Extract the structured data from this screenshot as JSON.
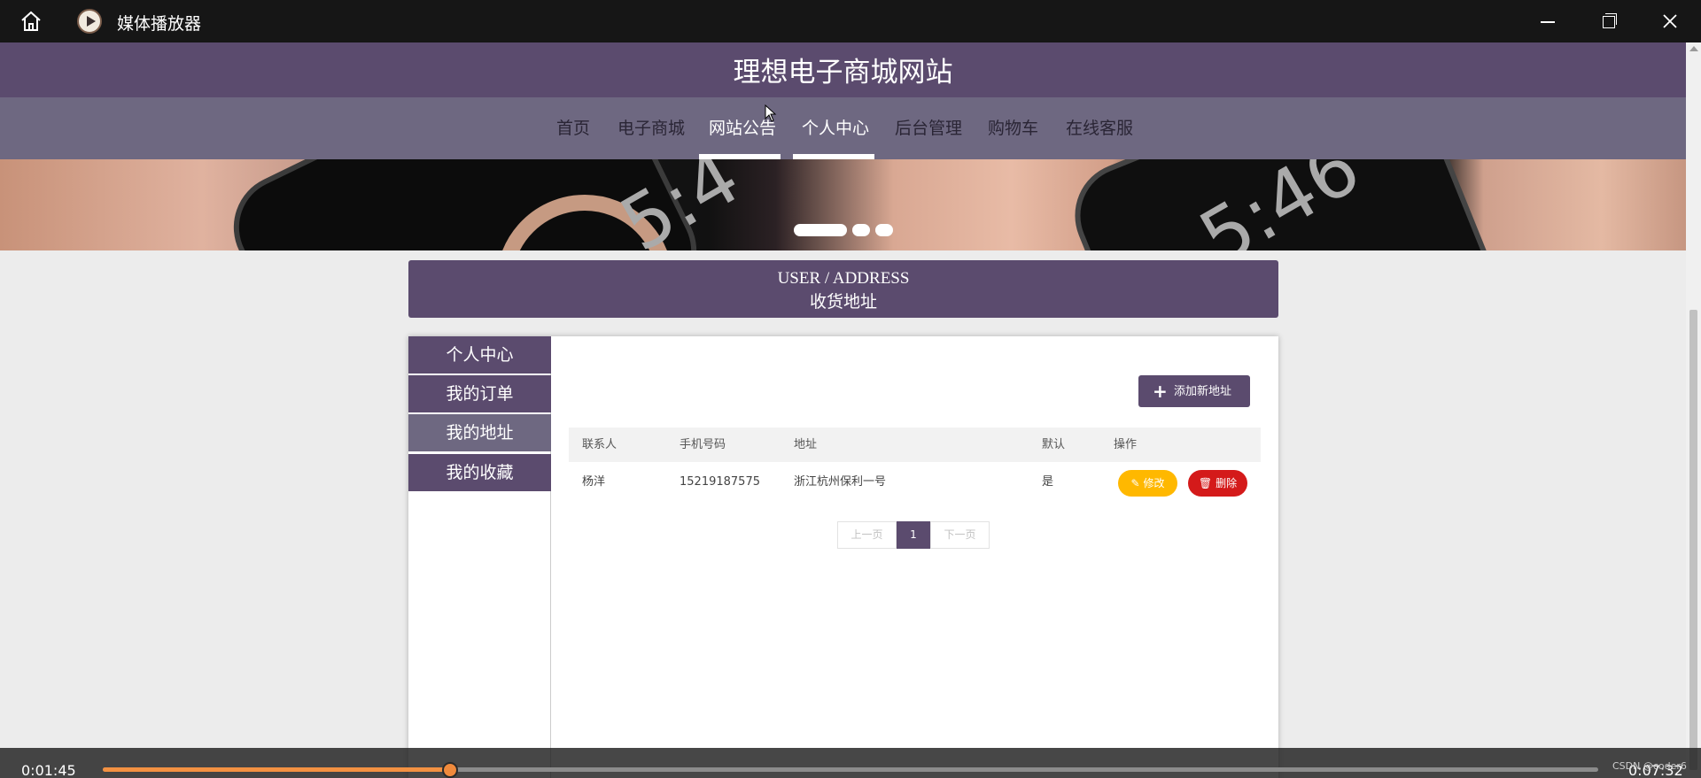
{
  "player": {
    "title": "媒体播放器",
    "current_time": "0:01:45",
    "total_time": "0:07:32",
    "progress": 0.2323,
    "watermark": "CSDN @coder6"
  },
  "site": {
    "title": "理想电子商城网站",
    "nav": [
      "首页",
      "电子商城",
      "网站公告",
      "个人中心",
      "后台管理",
      "购物车",
      "在线客服"
    ],
    "active_nav": [
      "网站公告",
      "个人中心"
    ]
  },
  "banner": {
    "clock_left": "5:4",
    "clock_right": "5:46",
    "slides": 3,
    "active_slide": 1
  },
  "section": {
    "title_en": "USER / ADDRESS",
    "title_cn": "收货地址"
  },
  "sidebar": {
    "items": [
      "个人中心",
      "我的订单",
      "我的地址",
      "我的收藏"
    ],
    "active": "我的地址"
  },
  "toolbar": {
    "add_label": "添加新地址"
  },
  "table": {
    "headers": [
      "联系人",
      "手机号码",
      "地址",
      "默认",
      "操作"
    ],
    "rows": [
      {
        "contact": "杨洋",
        "phone": "15219187575",
        "address": "浙江杭州保利一号",
        "default": "是",
        "edit": "修改",
        "delete": "删除"
      }
    ]
  },
  "pager": {
    "prev": "上一页",
    "current": "1",
    "next": "下一页"
  },
  "colors": {
    "primary": "#5b4b6e",
    "nav_bg": "#6e6881",
    "edit": "#ffb800",
    "delete": "#d41a1a",
    "progress": "#f39142"
  }
}
